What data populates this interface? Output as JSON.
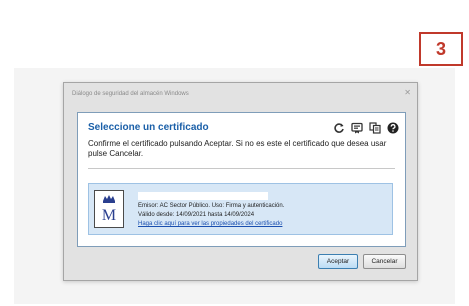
{
  "step_badge": "3",
  "dialog": {
    "title": "Diálogo de seguridad del almacén Windows",
    "close_symbol": "✕",
    "heading": "Seleccione un certificado",
    "instructions": "Confirme el certificado pulsando Aceptar. Si no es este el certificado que desea usar pulse Cancelar.",
    "toolbar_icons": [
      "refresh-icon",
      "certificate-view-icon",
      "certificate-store-icon",
      "help-icon"
    ],
    "certificate": {
      "issuer_line": "Emisor: AC Sector Público. Uso: Firma y autenticación.",
      "validity_line": "Válido desde: 14/09/2021 hasta 14/09/2024",
      "properties_link": "Haga clic aquí para ver las propiedades del certificado",
      "seal_letter": "M"
    },
    "buttons": {
      "accept": "Aceptar",
      "cancel": "Cancelar"
    }
  },
  "colors": {
    "heading": "#1a5fa8",
    "badge": "#c0392b",
    "cert_background": "#d7e7f6",
    "link": "#1a4fb0"
  }
}
